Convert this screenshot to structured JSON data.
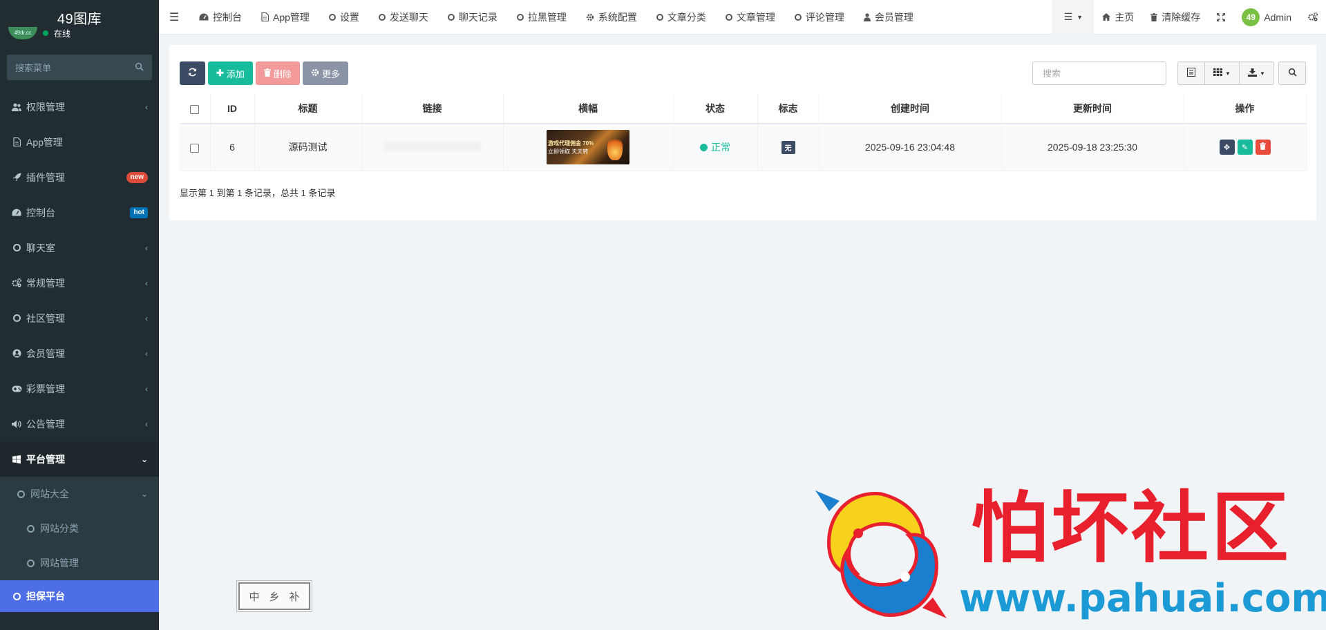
{
  "app": {
    "title": "49图库"
  },
  "sidebar": {
    "user_status": "在线",
    "search_placeholder": "搜索菜单",
    "items": [
      {
        "label": "权限管理",
        "icon": "users-icon"
      },
      {
        "label": "App管理",
        "icon": "file-icon"
      },
      {
        "label": "插件管理",
        "icon": "rocket-icon",
        "badge": "new"
      },
      {
        "label": "控制台",
        "icon": "dashboard-icon",
        "badge": "hot"
      },
      {
        "label": "聊天室",
        "icon": "circle-icon"
      },
      {
        "label": "常规管理",
        "icon": "cogs-icon"
      },
      {
        "label": "社区管理",
        "icon": "circle-icon"
      },
      {
        "label": "会员管理",
        "icon": "user-circle-icon"
      },
      {
        "label": "彩票管理",
        "icon": "gamepad-icon"
      },
      {
        "label": "公告管理",
        "icon": "volume-icon"
      },
      {
        "label": "平台管理",
        "icon": "windows-icon"
      }
    ],
    "sub_items": [
      {
        "label": "网站大全"
      },
      {
        "label": "网站分类"
      },
      {
        "label": "网站管理"
      }
    ],
    "active_item": {
      "label": "担保平台"
    }
  },
  "topnav": {
    "items": [
      {
        "label": "控制台",
        "icon": "dashboard-icon"
      },
      {
        "label": "App管理",
        "icon": "file-icon"
      },
      {
        "label": "设置",
        "icon": "circle-icon"
      },
      {
        "label": "发送聊天",
        "icon": "circle-icon"
      },
      {
        "label": "聊天记录",
        "icon": "circle-icon"
      },
      {
        "label": "拉黑管理",
        "icon": "circle-icon"
      },
      {
        "label": "系统配置",
        "icon": "gear-icon"
      },
      {
        "label": "文章分类",
        "icon": "circle-icon"
      },
      {
        "label": "文章管理",
        "icon": "circle-icon"
      },
      {
        "label": "评论管理",
        "icon": "circle-icon"
      },
      {
        "label": "会员管理",
        "icon": "user-icon"
      }
    ],
    "right": {
      "home": "主页",
      "clear_cache": "清除缓存",
      "admin": "Admin"
    }
  },
  "toolbar": {
    "add": "添加",
    "delete": "删除",
    "more": "更多",
    "search_placeholder": "搜索"
  },
  "table": {
    "columns": [
      "ID",
      "标题",
      "链接",
      "横幅",
      "状态",
      "标志",
      "创建时间",
      "更新时间",
      "操作"
    ],
    "rows": [
      {
        "id": "6",
        "title": "源码测试",
        "link": "",
        "banner_text_1": "游戏代理佣金 70%",
        "banner_text_2": "立即领取 天天转",
        "status": "正常",
        "flag": "无",
        "created": "2025-09-16 23:04:48",
        "updated": "2025-09-18 23:25:30"
      }
    ],
    "pagination_info": "显示第 1 到第 1 条记录，总共 1 条记录"
  },
  "watermark": {
    "stamp_chars": [
      "中",
      "乡",
      "补"
    ],
    "title": "怕坏社区",
    "url": "www.pahuai.com"
  },
  "colors": {
    "sidebar_bg": "#222d32",
    "active_item": "#4d6ee6",
    "success": "#18bc9c",
    "danger": "#e74c3c",
    "primary_dark": "#3c4b64",
    "watermark_red": "#e8202e",
    "watermark_blue": "#1b9ad6"
  }
}
